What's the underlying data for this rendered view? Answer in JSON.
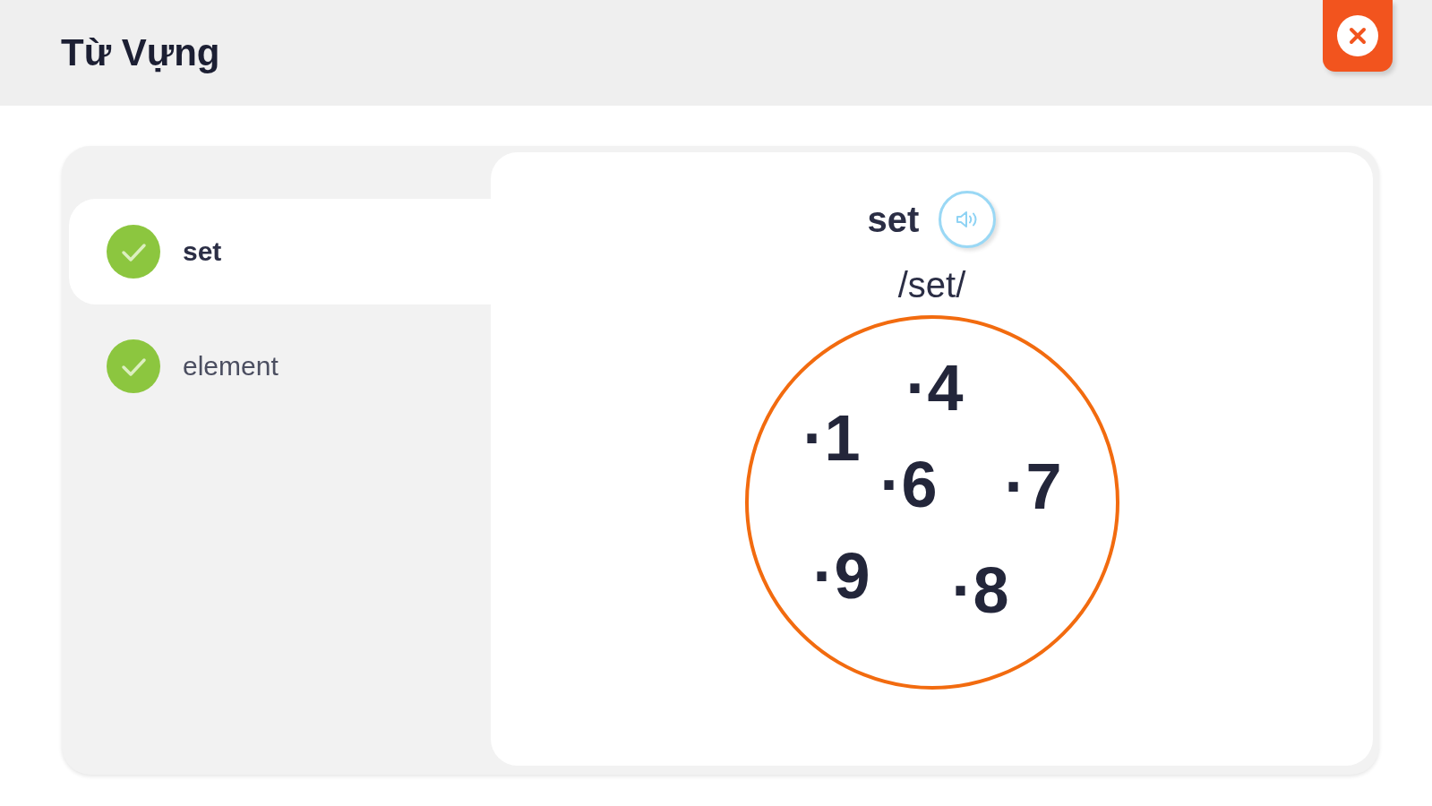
{
  "header": {
    "title": "Từ Vựng"
  },
  "word_list": [
    {
      "word": "set",
      "checked": true,
      "selected": true
    },
    {
      "word": "element",
      "checked": true,
      "selected": false
    }
  ],
  "detail": {
    "word": "set",
    "phonetic": "/set/",
    "illustration_labels": [
      "·4",
      "·1",
      "·6",
      "·7",
      "·9",
      "·8"
    ]
  }
}
